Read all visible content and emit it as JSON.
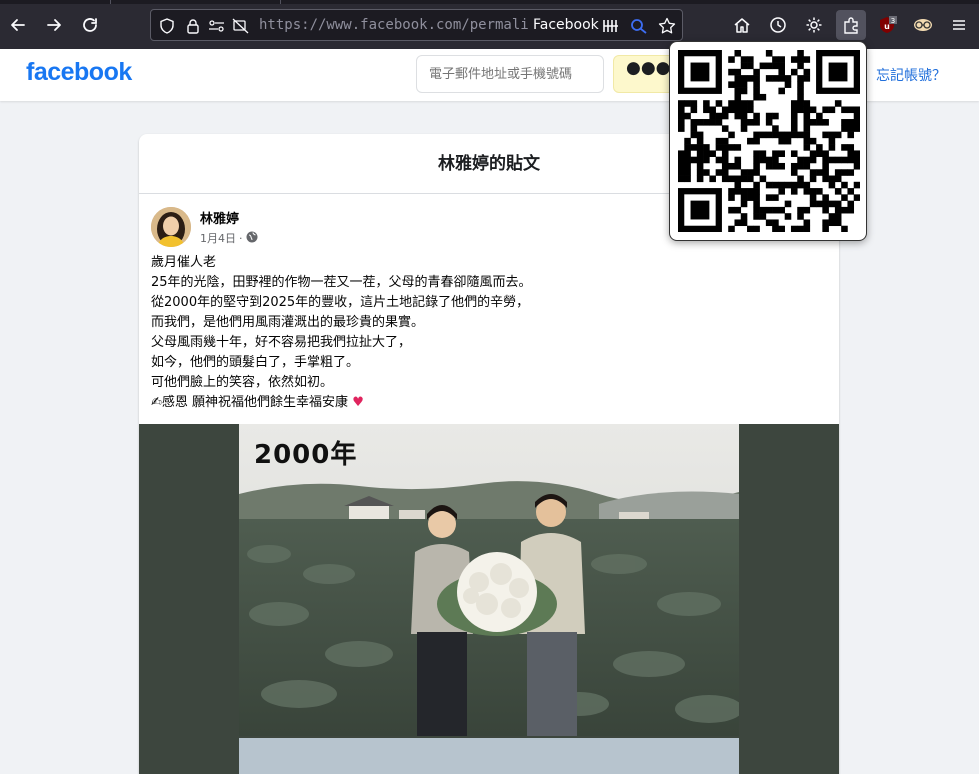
{
  "browser": {
    "url_text": "https://www.facebook.com/permalink",
    "page_title": "Facebook",
    "extension_badge": "3",
    "icons": [
      "back-icon",
      "forward-icon",
      "reload-icon",
      "shield-icon",
      "lock-icon",
      "permissions-icon",
      "camera-blocked-icon",
      "reader-icon",
      "search-lens-icon",
      "star-icon",
      "home-icon",
      "history-icon",
      "settings-icon",
      "extensions-icon",
      "ublock-icon",
      "reader-glasses-icon",
      "menu-icon"
    ]
  },
  "header": {
    "logo": "facebook",
    "email_placeholder": "電子郵件地址或手機號碼",
    "password_mask": "●●●●●●●",
    "forgot_link": "忘記帳號？"
  },
  "post": {
    "page_title": "林雅婷的貼文",
    "author": "林雅婷",
    "date": "1月4日",
    "meta_sep": "·",
    "lines": [
      "歲月催人老",
      "25年的光陰，田野裡的作物一茬又一茬，父母的青春卻隨風而去。",
      "從2000年的堅守到2025年的豐收，這片土地記錄了他們的辛勞，",
      "而我們，是他們用風雨灌溉出的最珍貴的果實。",
      "父母風雨幾十年，好不容易把我們拉扯大了，",
      "如今，他們的頭髮白了，手掌粗了。",
      "可他們臉上的笑容，依然如初。"
    ],
    "last_line_prefix": "✍",
    "last_line": "感恩 願神祝福他們餘生幸福安康",
    "heart": "♥",
    "photo_caption": "2000年"
  },
  "colors": {
    "fb_blue": "#1877f2",
    "browser_dark": "#2b2a33",
    "page_bg": "#f0f2f5"
  }
}
